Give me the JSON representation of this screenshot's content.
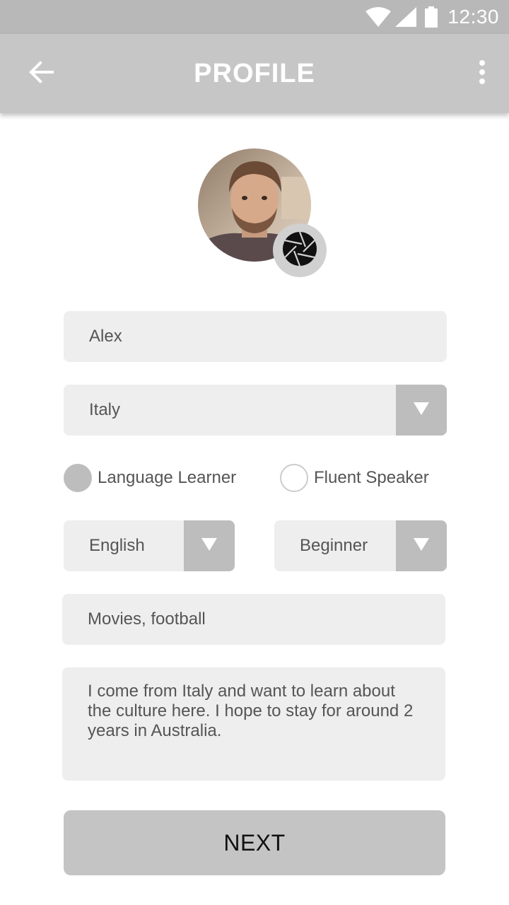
{
  "status_bar": {
    "time": "12:30",
    "icons": [
      "wifi-icon",
      "cellular-signal-icon",
      "battery-icon"
    ]
  },
  "app_bar": {
    "title": "PROFILE",
    "back_icon": "arrow-left-icon",
    "more_icon": "more-vertical-icon"
  },
  "profile": {
    "avatar_icon": "user-photo",
    "camera_icon": "camera-aperture-icon"
  },
  "form": {
    "name": "Alex",
    "country": "Italy",
    "roles": [
      {
        "label": "Language Learner",
        "selected": true
      },
      {
        "label": "Fluent Speaker",
        "selected": false
      }
    ],
    "language": "English",
    "level": "Beginner",
    "interests": "Movies, football",
    "bio": "I come from Italy and want to learn about the culture here. I hope to stay for around 2 years in Australia."
  },
  "actions": {
    "next_label": "NEXT"
  },
  "colors": {
    "status_bar": "#b8b8b8",
    "app_bar": "#c6c6c6",
    "field_bg": "#eeeeee",
    "dropdown_bg": "#bdbdbd",
    "button_bg": "#c4c4c4"
  }
}
